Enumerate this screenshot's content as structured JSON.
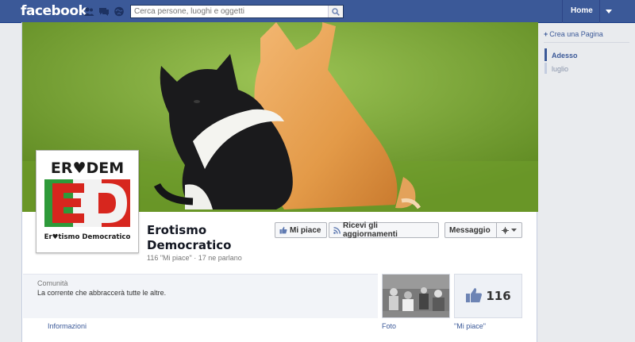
{
  "topbar": {
    "logo": "facebook",
    "search_placeholder": "Cerca persone, luoghi e oggetti",
    "home_label": "Home",
    "icons": [
      "friends-icon",
      "messages-icon",
      "notifications-icon",
      "search-icon",
      "caret-down-icon"
    ]
  },
  "page": {
    "name": "Erotismo Democratico",
    "stats": "116 \"Mi piace\" · 17 ne parlano",
    "logo_top_text": "ER♥DEM",
    "logo_bottom_text": "Er♥tismo Democratico",
    "logo_letters": "ED"
  },
  "actions": {
    "like_label": "Mi piace",
    "subscribe_label": "Ricevi gli aggiornamenti",
    "message_label": "Messaggio"
  },
  "info": {
    "category": "Comunità",
    "about": "La corrente che abbraccerà tutte le altre.",
    "info_link": "Informazioni"
  },
  "apps": {
    "photos_label": "Foto",
    "likes_label": "\"Mi piace\"",
    "likes_count": "116"
  },
  "sidebar": {
    "create_page": "Crea una Pagina",
    "timeline": [
      {
        "label": "Adesso"
      },
      {
        "label": "luglio"
      }
    ]
  },
  "colors": {
    "brand_blue": "#3b5998",
    "logo_green": "#2e9a3a",
    "logo_red": "#d7261e",
    "heart_red": "#d7261e"
  }
}
